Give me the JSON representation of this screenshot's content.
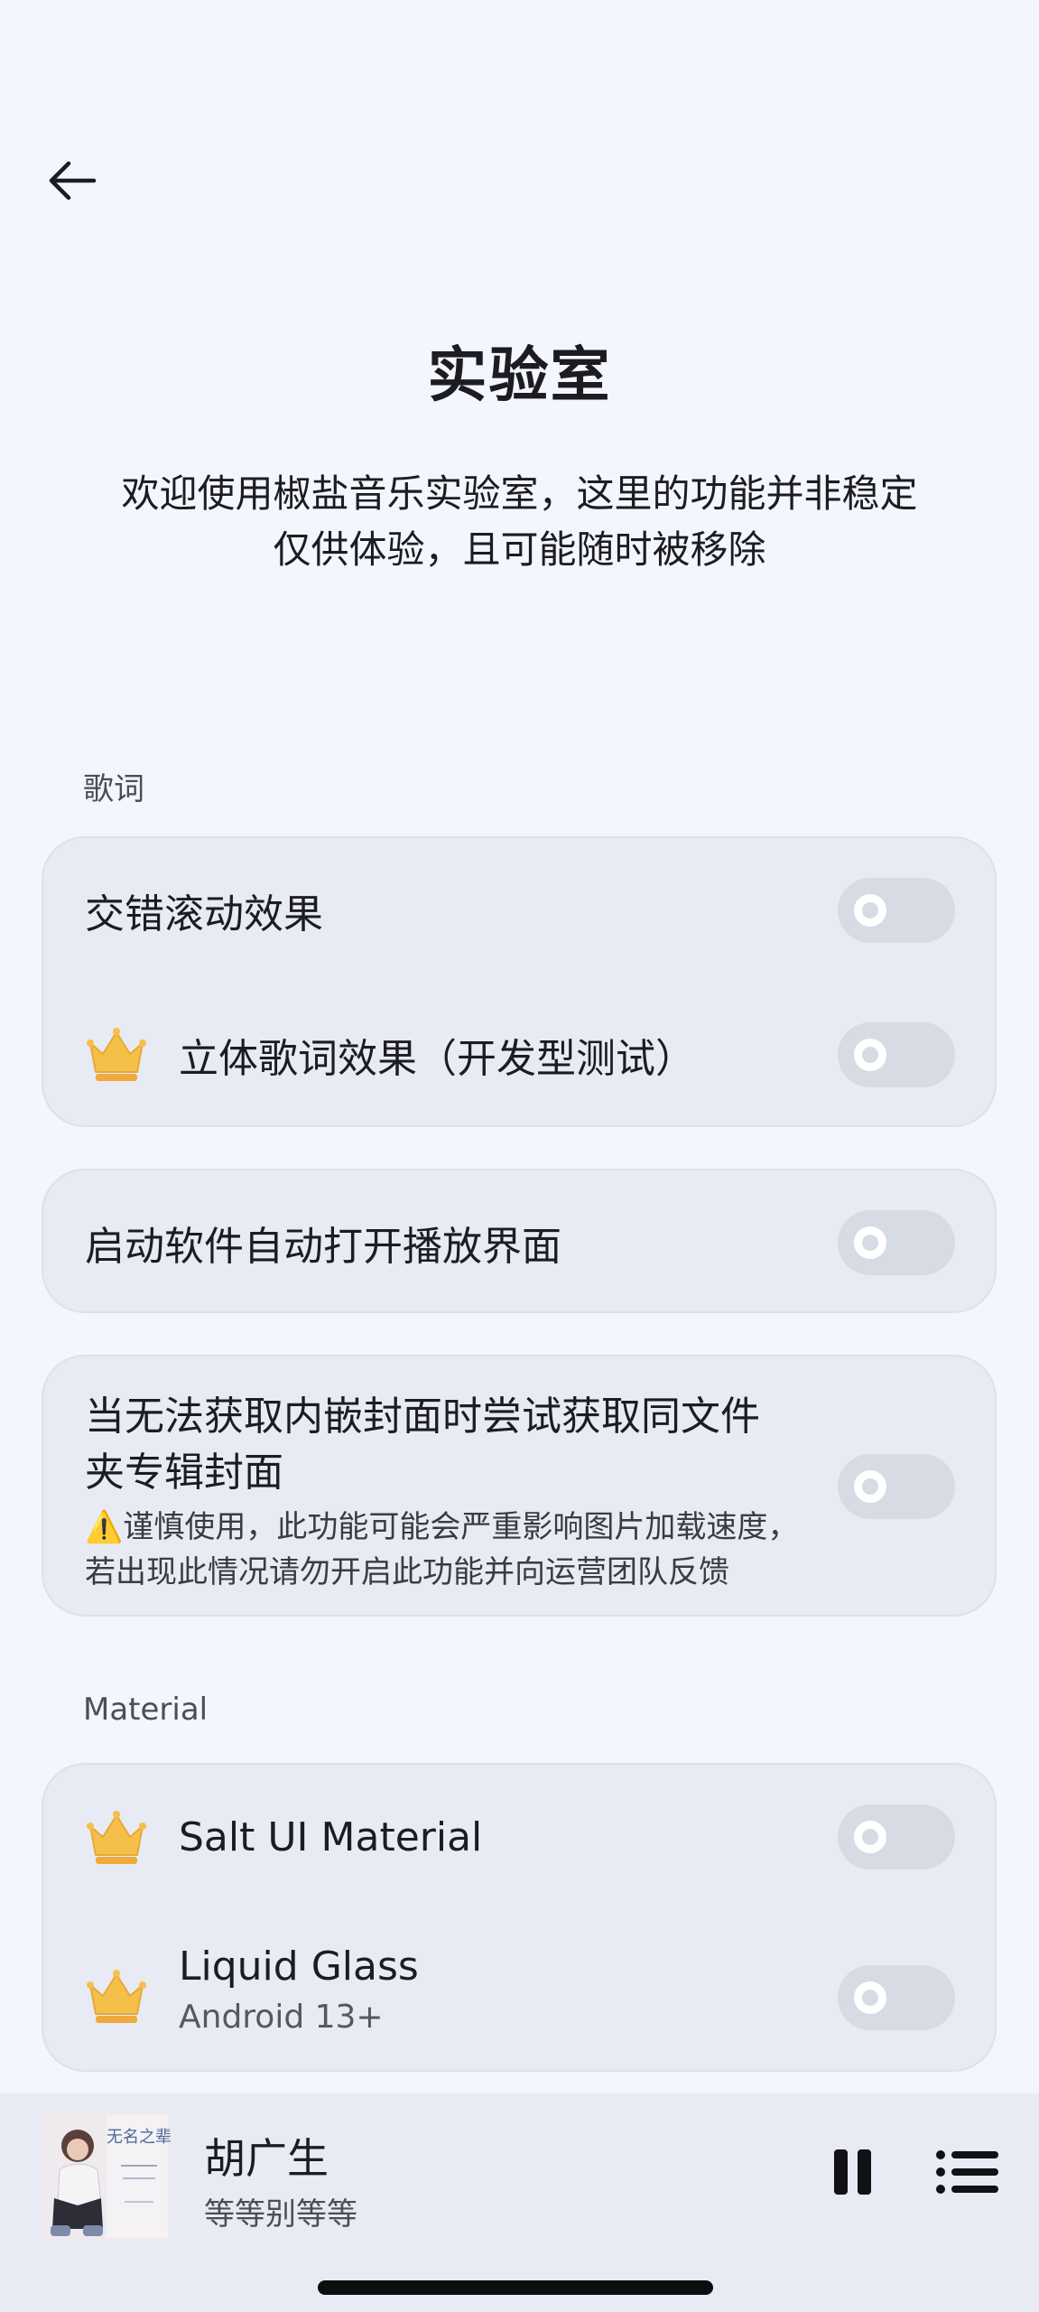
{
  "header": {
    "title": "实验室",
    "description_line1": "欢迎使用椒盐音乐实验室，这里的功能并非稳定",
    "description_line2": "仅供体验，且可能随时被移除"
  },
  "sections": {
    "lyrics": {
      "label": "歌词",
      "items": [
        {
          "label": "交错滚动效果",
          "enabled": false
        },
        {
          "label": "立体歌词效果（开发型测试）",
          "enabled": false,
          "icon": "crown-icon"
        }
      ]
    },
    "autoplay": {
      "label": "启动软件自动打开播放界面",
      "enabled": false
    },
    "cover": {
      "label_line1": "当无法获取内嵌封面时尝试获取同文件",
      "label_line2": "夹专辑封面",
      "warning_line1": "⚠️谨慎使用，此功能可能会严重影响图片加载速度，",
      "warning_line2": "若出现此情况请勿开启此功能并向运营团队反馈",
      "enabled": false
    },
    "material": {
      "label": "Material",
      "items": [
        {
          "label": "Salt UI Material",
          "enabled": false,
          "icon": "crown-icon"
        },
        {
          "label": "Liquid Glass",
          "sublabel": "Android 13+",
          "enabled": false,
          "icon": "crown-icon"
        }
      ]
    }
  },
  "player": {
    "song_title": "胡广生",
    "artist": "等等别等等",
    "album_art_text": "无名之辈"
  },
  "colors": {
    "background": "#f3f6fc",
    "card": "#e8ebf3",
    "toggle_off": "#d7dbe3",
    "crown": "#f5c04a"
  }
}
